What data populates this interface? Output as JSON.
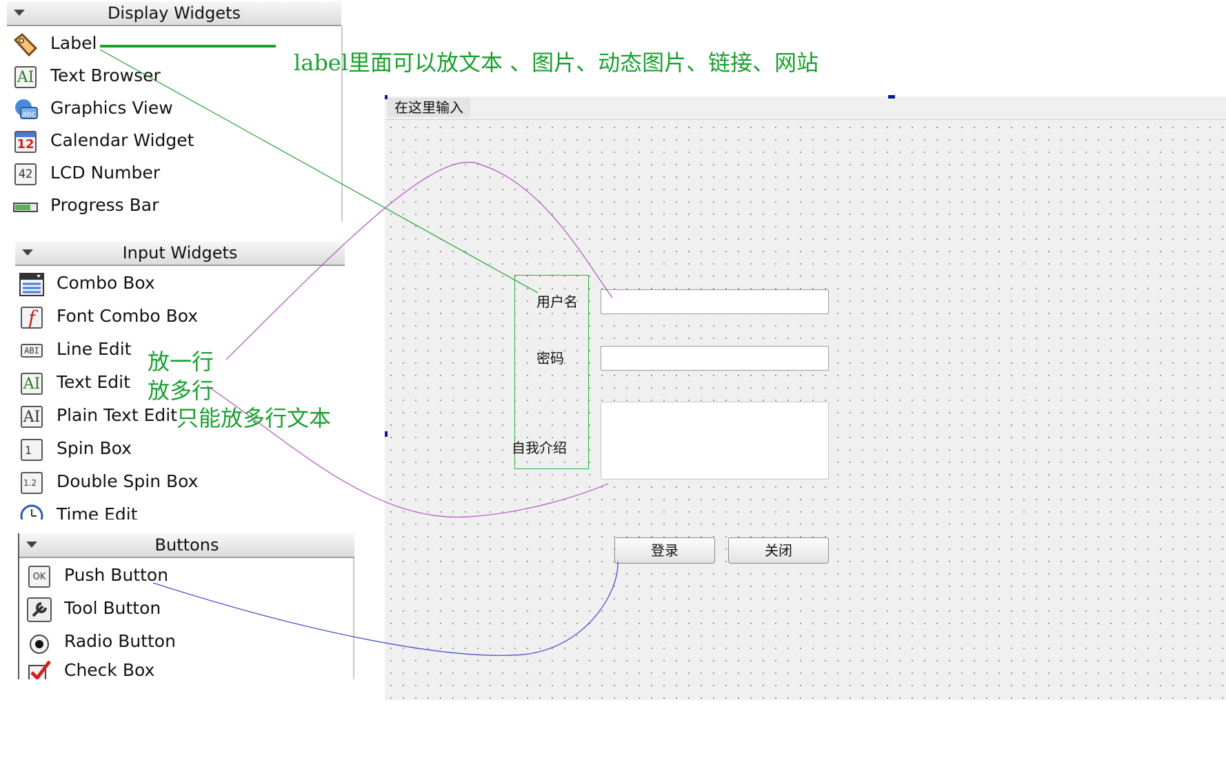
{
  "display_widgets": {
    "title": "Display Widgets",
    "items": [
      {
        "label": "Label",
        "icon": "label-tag-icon"
      },
      {
        "label": "Text Browser",
        "icon": "text-browser-icon"
      },
      {
        "label": "Graphics View",
        "icon": "graphics-view-icon"
      },
      {
        "label": "Calendar Widget",
        "icon": "calendar-icon",
        "icon_text": "12"
      },
      {
        "label": "LCD Number",
        "icon": "lcd-number-icon",
        "icon_text": "42"
      },
      {
        "label": "Progress Bar",
        "icon": "progress-bar-icon"
      }
    ]
  },
  "input_widgets": {
    "title": "Input Widgets",
    "items": [
      {
        "label": "Combo Box",
        "icon": "combo-box-icon"
      },
      {
        "label": "Font Combo Box",
        "icon": "font-combo-box-icon"
      },
      {
        "label": "Line Edit",
        "icon": "line-edit-icon",
        "icon_text": "ABI"
      },
      {
        "label": "Text Edit",
        "icon": "text-edit-icon",
        "icon_text": "AI"
      },
      {
        "label": "Plain Text Edit",
        "icon": "plain-text-edit-icon",
        "icon_text": "AI"
      },
      {
        "label": "Spin Box",
        "icon": "spin-box-icon",
        "icon_text": "1"
      },
      {
        "label": "Double Spin Box",
        "icon": "double-spin-box-icon",
        "icon_text": "1.2"
      },
      {
        "label": "Time Edit",
        "icon": "time-edit-icon"
      }
    ]
  },
  "buttons_group": {
    "title": "Buttons",
    "items": [
      {
        "label": "Push Button",
        "icon": "push-button-icon",
        "icon_text": "OK"
      },
      {
        "label": "Tool Button",
        "icon": "tool-button-icon"
      },
      {
        "label": "Radio Button",
        "icon": "radio-button-icon"
      },
      {
        "label": "Check Box",
        "icon": "check-box-icon"
      }
    ]
  },
  "annotations": {
    "label_note": "label里面可以放文本 、图片、动态图片、链接、网站",
    "line_edit_note": "放一行",
    "text_edit_note": "放多行",
    "plain_text_note": "只能放多行文本"
  },
  "form": {
    "menu_item": "在这里输入",
    "username_label": "用户名",
    "password_label": "密码",
    "intro_label": "自我介绍",
    "login_button": "登录",
    "close_button": "关闭"
  },
  "colors": {
    "annotation_green": "#1aa02e",
    "curve_purple": "#b050c0",
    "curve_blue": "#3848c8"
  }
}
